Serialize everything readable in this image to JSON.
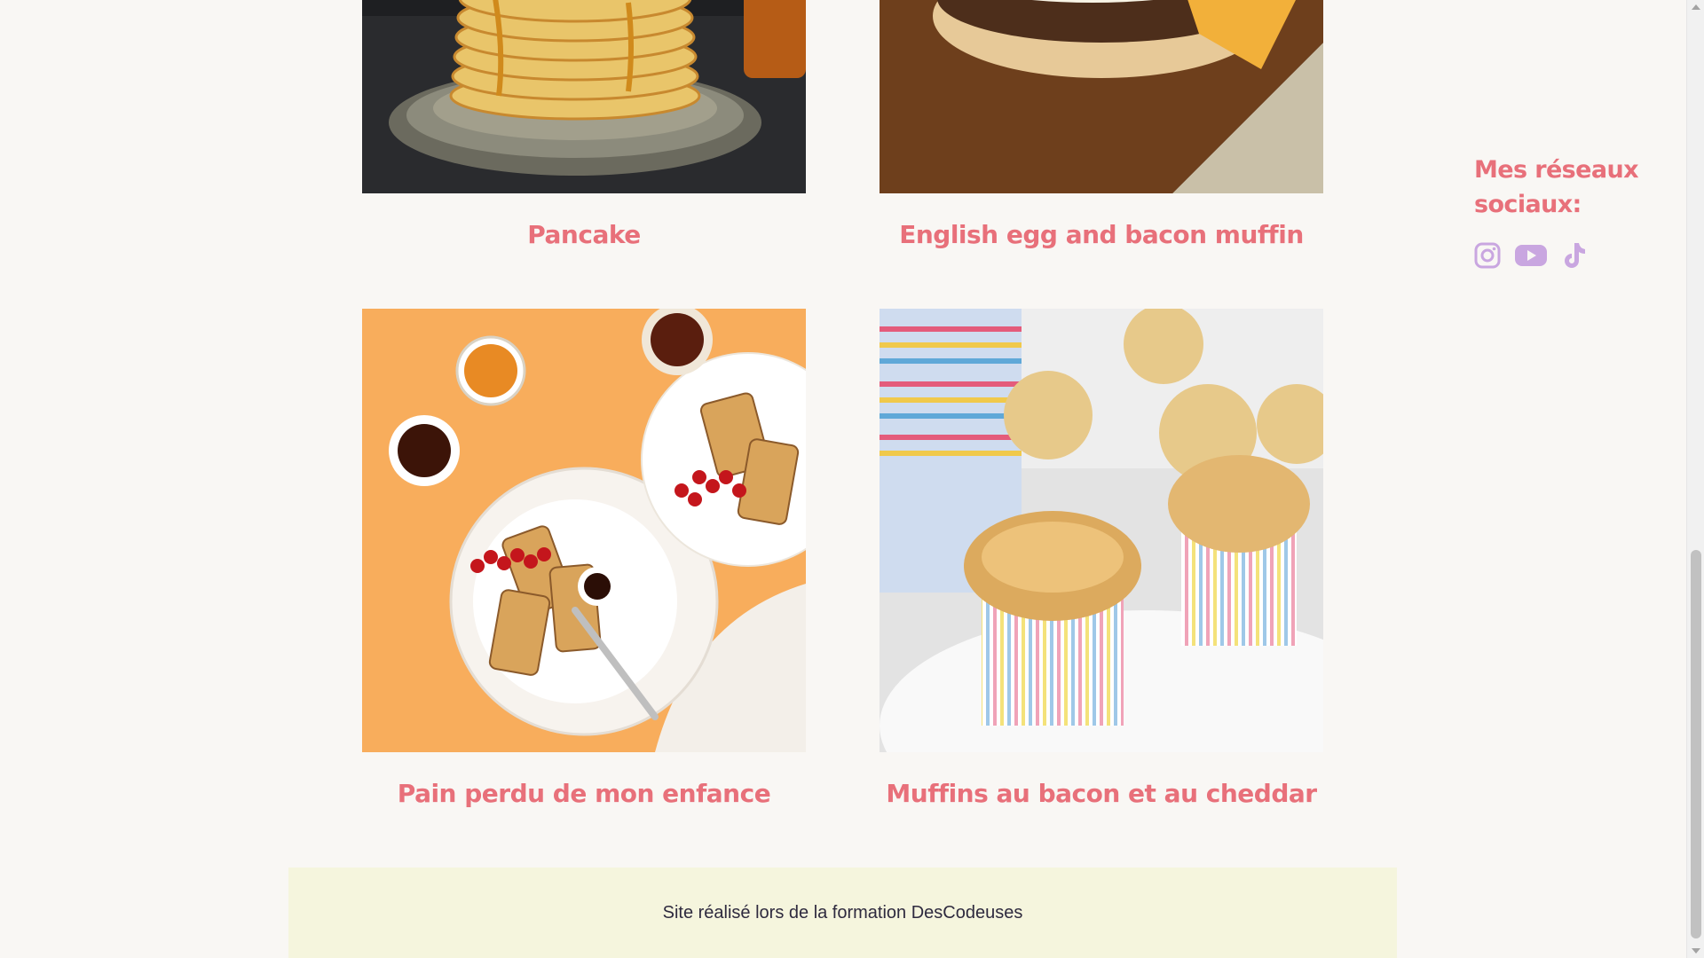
{
  "recipes": [
    {
      "title": "Pancake",
      "image": "pancake-stack-photo"
    },
    {
      "title": "English egg and bacon muffin",
      "image": "egg-bacon-muffin-photo"
    },
    {
      "title": "Pain perdu de mon enfance",
      "image": "french-toast-photo"
    },
    {
      "title": "Muffins au bacon et au cheddar",
      "image": "cheddar-muffins-photo"
    }
  ],
  "social": {
    "title": "Mes réseaux sociaux:",
    "icons": [
      "instagram-icon",
      "youtube-icon",
      "tiktok-icon"
    ],
    "icon_color": "#c9a6e0"
  },
  "footer": {
    "text": "Site réalisé lors de la formation DesCodeuses"
  },
  "colors": {
    "accent": "#e8707a",
    "background": "#f9f7f4",
    "footer_bg": "#f5f5dd"
  }
}
